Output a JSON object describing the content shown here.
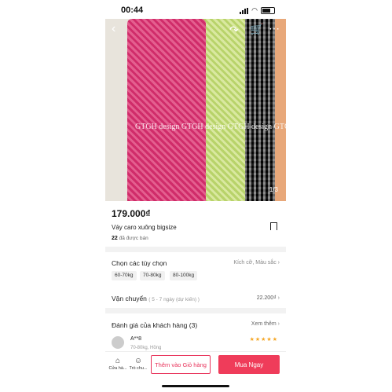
{
  "status_bar": {
    "time": "00:44"
  },
  "gallery": {
    "watermark": "GTGH design GTGH design GTGH design GTGH design",
    "counter": "1/3"
  },
  "product": {
    "price": "179.000₫",
    "name": "Váy caro xuông bigsize",
    "sold_count": "22",
    "sold_label": "đã được bán"
  },
  "options": {
    "title": "Chọn các tùy chọn",
    "summary": "Kích cỡ, Màu sắc",
    "sizes": [
      "60-70kg",
      "70-80kg",
      "80-100kg"
    ]
  },
  "shipping": {
    "title": "Vận chuyển",
    "eta": "( 5 - 7 ngày (dự kiến) )",
    "fee": "22.200₫"
  },
  "reviews": {
    "title": "Đánh giá của khách hàng (3)",
    "see_more": "Xem thêm",
    "first": {
      "name": "A**8",
      "detail": "70-80kg, Hồng",
      "stars": "★★★★★"
    }
  },
  "bottom_bar": {
    "shop_label": "Cửa hà...",
    "chat_label": "Trò chu...",
    "add_to_cart": "Thêm vào Giỏ hàng",
    "buy_now": "Mua Ngay"
  }
}
